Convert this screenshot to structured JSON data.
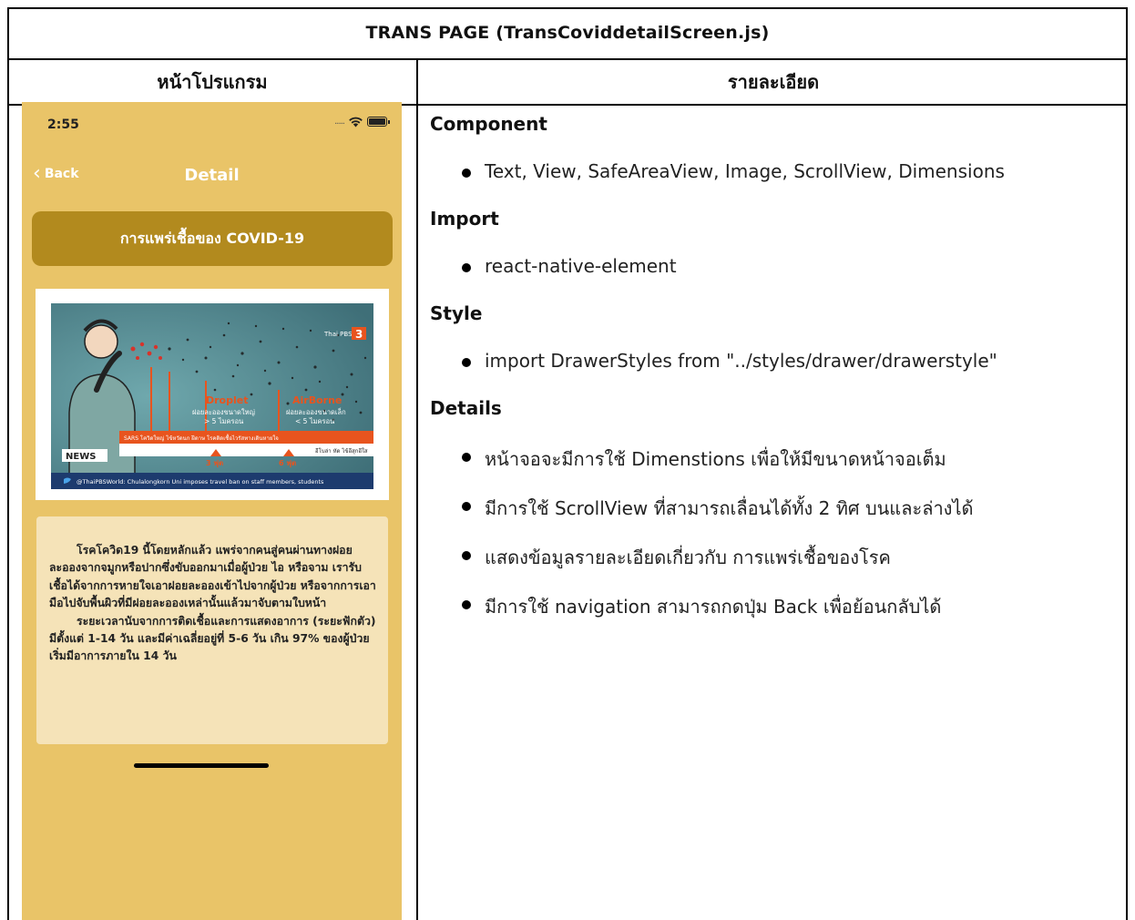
{
  "document": {
    "title": "TRANS PAGE (TransCoviddetailScreen.js)",
    "col_left_header": "หน้าโปรแกรม",
    "col_right_header": "รายละเอียด"
  },
  "phone": {
    "status_time": "2:55",
    "status_dots": ".....",
    "back_label": "Back",
    "nav_title": "Detail",
    "banner_title": "การแพร่เชื้อของ COVID-19",
    "image": {
      "droplet_label": "Droplet",
      "droplet_desc": "ฝอยละอองขนาดใหญ่",
      "droplet_size": "> 5 ไมครอน",
      "airborne_label": "AirBorne",
      "airborne_desc": "ฝอยละอองขนาดเล็ก",
      "airborne_size": "< 5 ไมครอน",
      "strip_text": "SARS โควิดใหญ่ ไข้หวัดนก ฝีดาษ โรคติดเชื้อไวรัสทางเดินหายใจ",
      "strip_right": "อีโบล่า หัด ไข้อีสุกอีใส",
      "dist_1": "3 ฟุต",
      "dist_2": "6 ฟุต",
      "news_label": "NEWS",
      "channel_label": "Thai PBS",
      "channel_number": "3",
      "ticker": "@ThaiPBSWorld: Chulalongkorn Uni imposes travel ban on staff members, students"
    },
    "body_para1": "โรคโควิด19 นี้โดยหลักแล้ว แพร่จากคนสู่คนผ่านทางฝอยละอองจากจมูกหรือปากซึ่งขับออกมาเมื่อผู้ป่วย ไอ หรือจาม เรารับเชื้อได้จากการหายใจเอาฝอยละอองเข้าไปจากผู้ป่วย หรือจากการเอามือไปจับพื้นผิวที่มีฝอยละอองเหล่านั้นแล้วมาจับตามใบหน้า",
    "body_para2": "ระยะเวลานับจากการติดเชื้อและการแสดงอาการ (ระยะฟักตัว) มีตั้งแต่ 1-14 วัน และมีค่าเฉลี่ยอยู่ที่ 5-6 วัน เกิน 97% ของผู้ป่วยเริ่มมีอาการภายใน 14 วัน"
  },
  "details": {
    "component_title": "Component",
    "component_items": [
      "Text, View, SafeAreaView, Image, ScrollView, Dimensions"
    ],
    "import_title": "Import",
    "import_items": [
      "react-native-element"
    ],
    "style_title": "Style",
    "style_items": [
      "import DrawerStyles from \"../styles/drawer/drawerstyle\""
    ],
    "details_title": "Details",
    "details_items": [
      "หน้าจอจะมีการใช้ Dimenstions เพื่อให้มีขนาดหน้าจอเต็ม",
      "มีการใช้ ScrollView ที่สามารถเลื่อนได้ทั้ง 2 ทิศ บนและล่างได้",
      "แสดงข้อมูลรายละเอียดเกี่ยวกับ การแพร่เชื้อของโรค",
      "มีการใช้ navigation สามารถกดปุ่ม Back เพื่อย้อนกลับได้"
    ]
  },
  "colors": {
    "phone_bg": "#e9c468",
    "banner_bg": "#b28a1e",
    "text_card_bg": "#f5e3b8",
    "accent_orange": "#e8541e"
  }
}
